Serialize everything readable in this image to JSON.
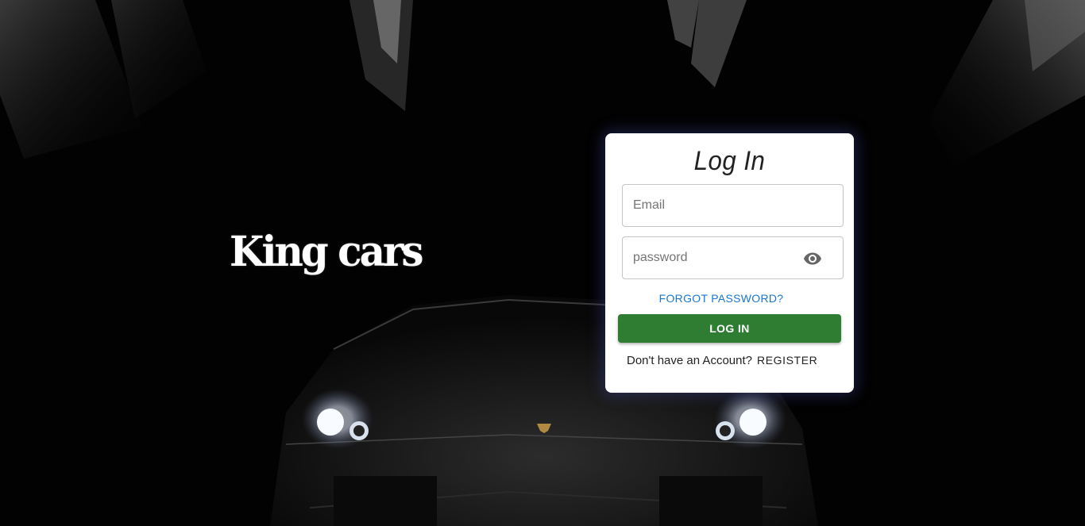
{
  "brand": {
    "name": "King cars"
  },
  "login": {
    "title": "Log In",
    "email_placeholder": "Email",
    "password_placeholder": "password",
    "forgot_label": "FORGOT PASSWORD?",
    "submit_label": "LOG IN",
    "no_account_text": "Don't have an Account?",
    "register_label": "REGISTER"
  },
  "colors": {
    "accent": "#2e7d32",
    "link": "#1976d2",
    "card": "#ffffff",
    "background": "#020202"
  },
  "icons": {
    "password_toggle": "eye-icon"
  }
}
